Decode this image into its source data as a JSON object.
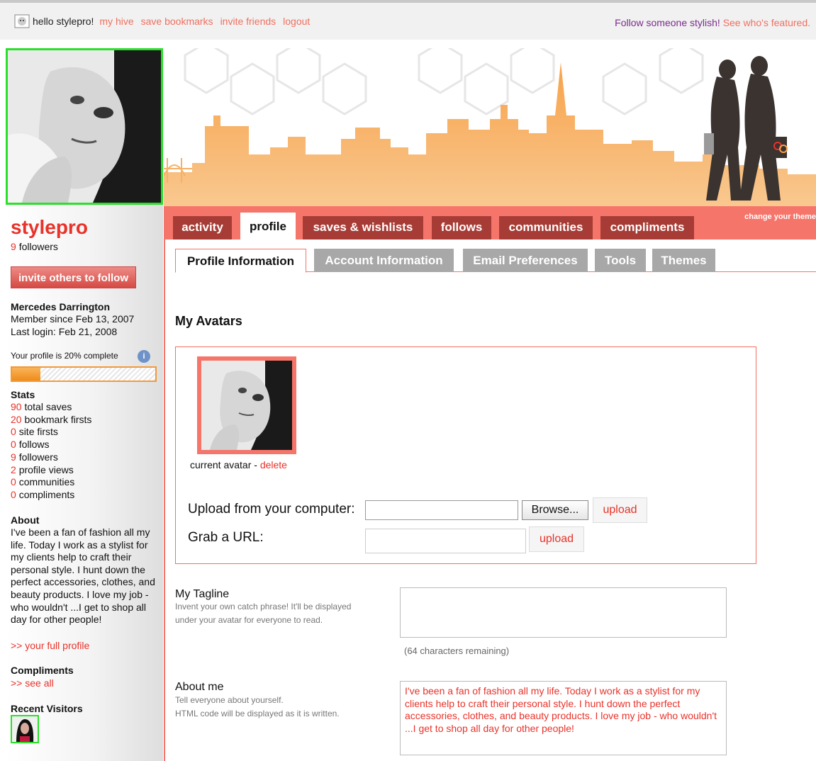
{
  "topbar": {
    "greeting": "hello stylepro!",
    "links": [
      "my hive",
      "save bookmarks",
      "invite friends",
      "logout"
    ],
    "follow_prompt": "Follow someone stylish!",
    "featured_link": "See who's featured."
  },
  "sidebar": {
    "username": "stylepro",
    "followers_count": "9",
    "followers_label": "followers",
    "invite_button": "invite others to follow",
    "full_name": "Mercedes Darrington",
    "member_since": "Member since Feb 13, 2007",
    "last_login": "Last login: Feb 21, 2008",
    "profile_complete_text": "Your profile is 20% complete",
    "profile_complete_fraction": 0.2,
    "stats_heading": "Stats",
    "stats": [
      {
        "count": "90",
        "label": "total saves"
      },
      {
        "count": "20",
        "label": "bookmark firsts"
      },
      {
        "count": "0",
        "label": "site firsts"
      },
      {
        "count": "0",
        "label": "follows"
      },
      {
        "count": "9",
        "label": "followers"
      },
      {
        "count": "2",
        "label": "profile views"
      },
      {
        "count": "0",
        "label": "communities"
      },
      {
        "count": "0",
        "label": "compliments"
      }
    ],
    "about_heading": "About",
    "about_text": "I've been a fan of fashion all my life. Today I work as a stylist for my clients help to craft their personal style. I hunt down the perfect accessories, clothes, and beauty products. I love my job - who wouldn't ...I get to shop all day for other people!",
    "full_profile_link": ">> your full profile",
    "compliments_heading": "Compliments",
    "see_all_link": ">> see all",
    "recent_visitors_heading": "Recent Visitors"
  },
  "tabs": {
    "change_theme": "change your theme",
    "items": [
      "activity",
      "profile",
      "saves & wishlists",
      "follows",
      "communities",
      "compliments"
    ],
    "active": "profile"
  },
  "subtabs": {
    "items": [
      "Profile Information",
      "Account Information",
      "Email Preferences",
      "Tools",
      "Themes"
    ],
    "active": "Profile Information"
  },
  "avatars": {
    "title": "My Avatars",
    "current_label": "current avatar - ",
    "delete_link": "delete",
    "upload_computer_label": "Upload from your computer:",
    "browse_button": "Browse...",
    "upload_button": "upload",
    "grab_url_label": "Grab a URL:"
  },
  "tagline": {
    "label": "My Tagline",
    "help_1": "Invent your own catch phrase! It'll be displayed",
    "help_2": "under your avatar for everyone to read.",
    "value": "",
    "chars_remaining": "(64 characters remaining)"
  },
  "about_me": {
    "label": "About me",
    "help_1": "Tell everyone about yourself.",
    "help_2": "HTML code will be displayed as it is written.",
    "value": "I've been a fan of  fashion all my life.  Today I  work as a stylist for my clients help to craft their personal style. I hunt down the perfect accessories, clothes, and beauty products. I love my job - who wouldn't ...I get to shop all day for other people!"
  },
  "colors": {
    "accent_red": "#e8322a",
    "tab_salmon": "#f6756a",
    "tab_dark": "#a63c35",
    "highlight_green": "#2be02b",
    "skyline_orange": "#f7a24a"
  }
}
